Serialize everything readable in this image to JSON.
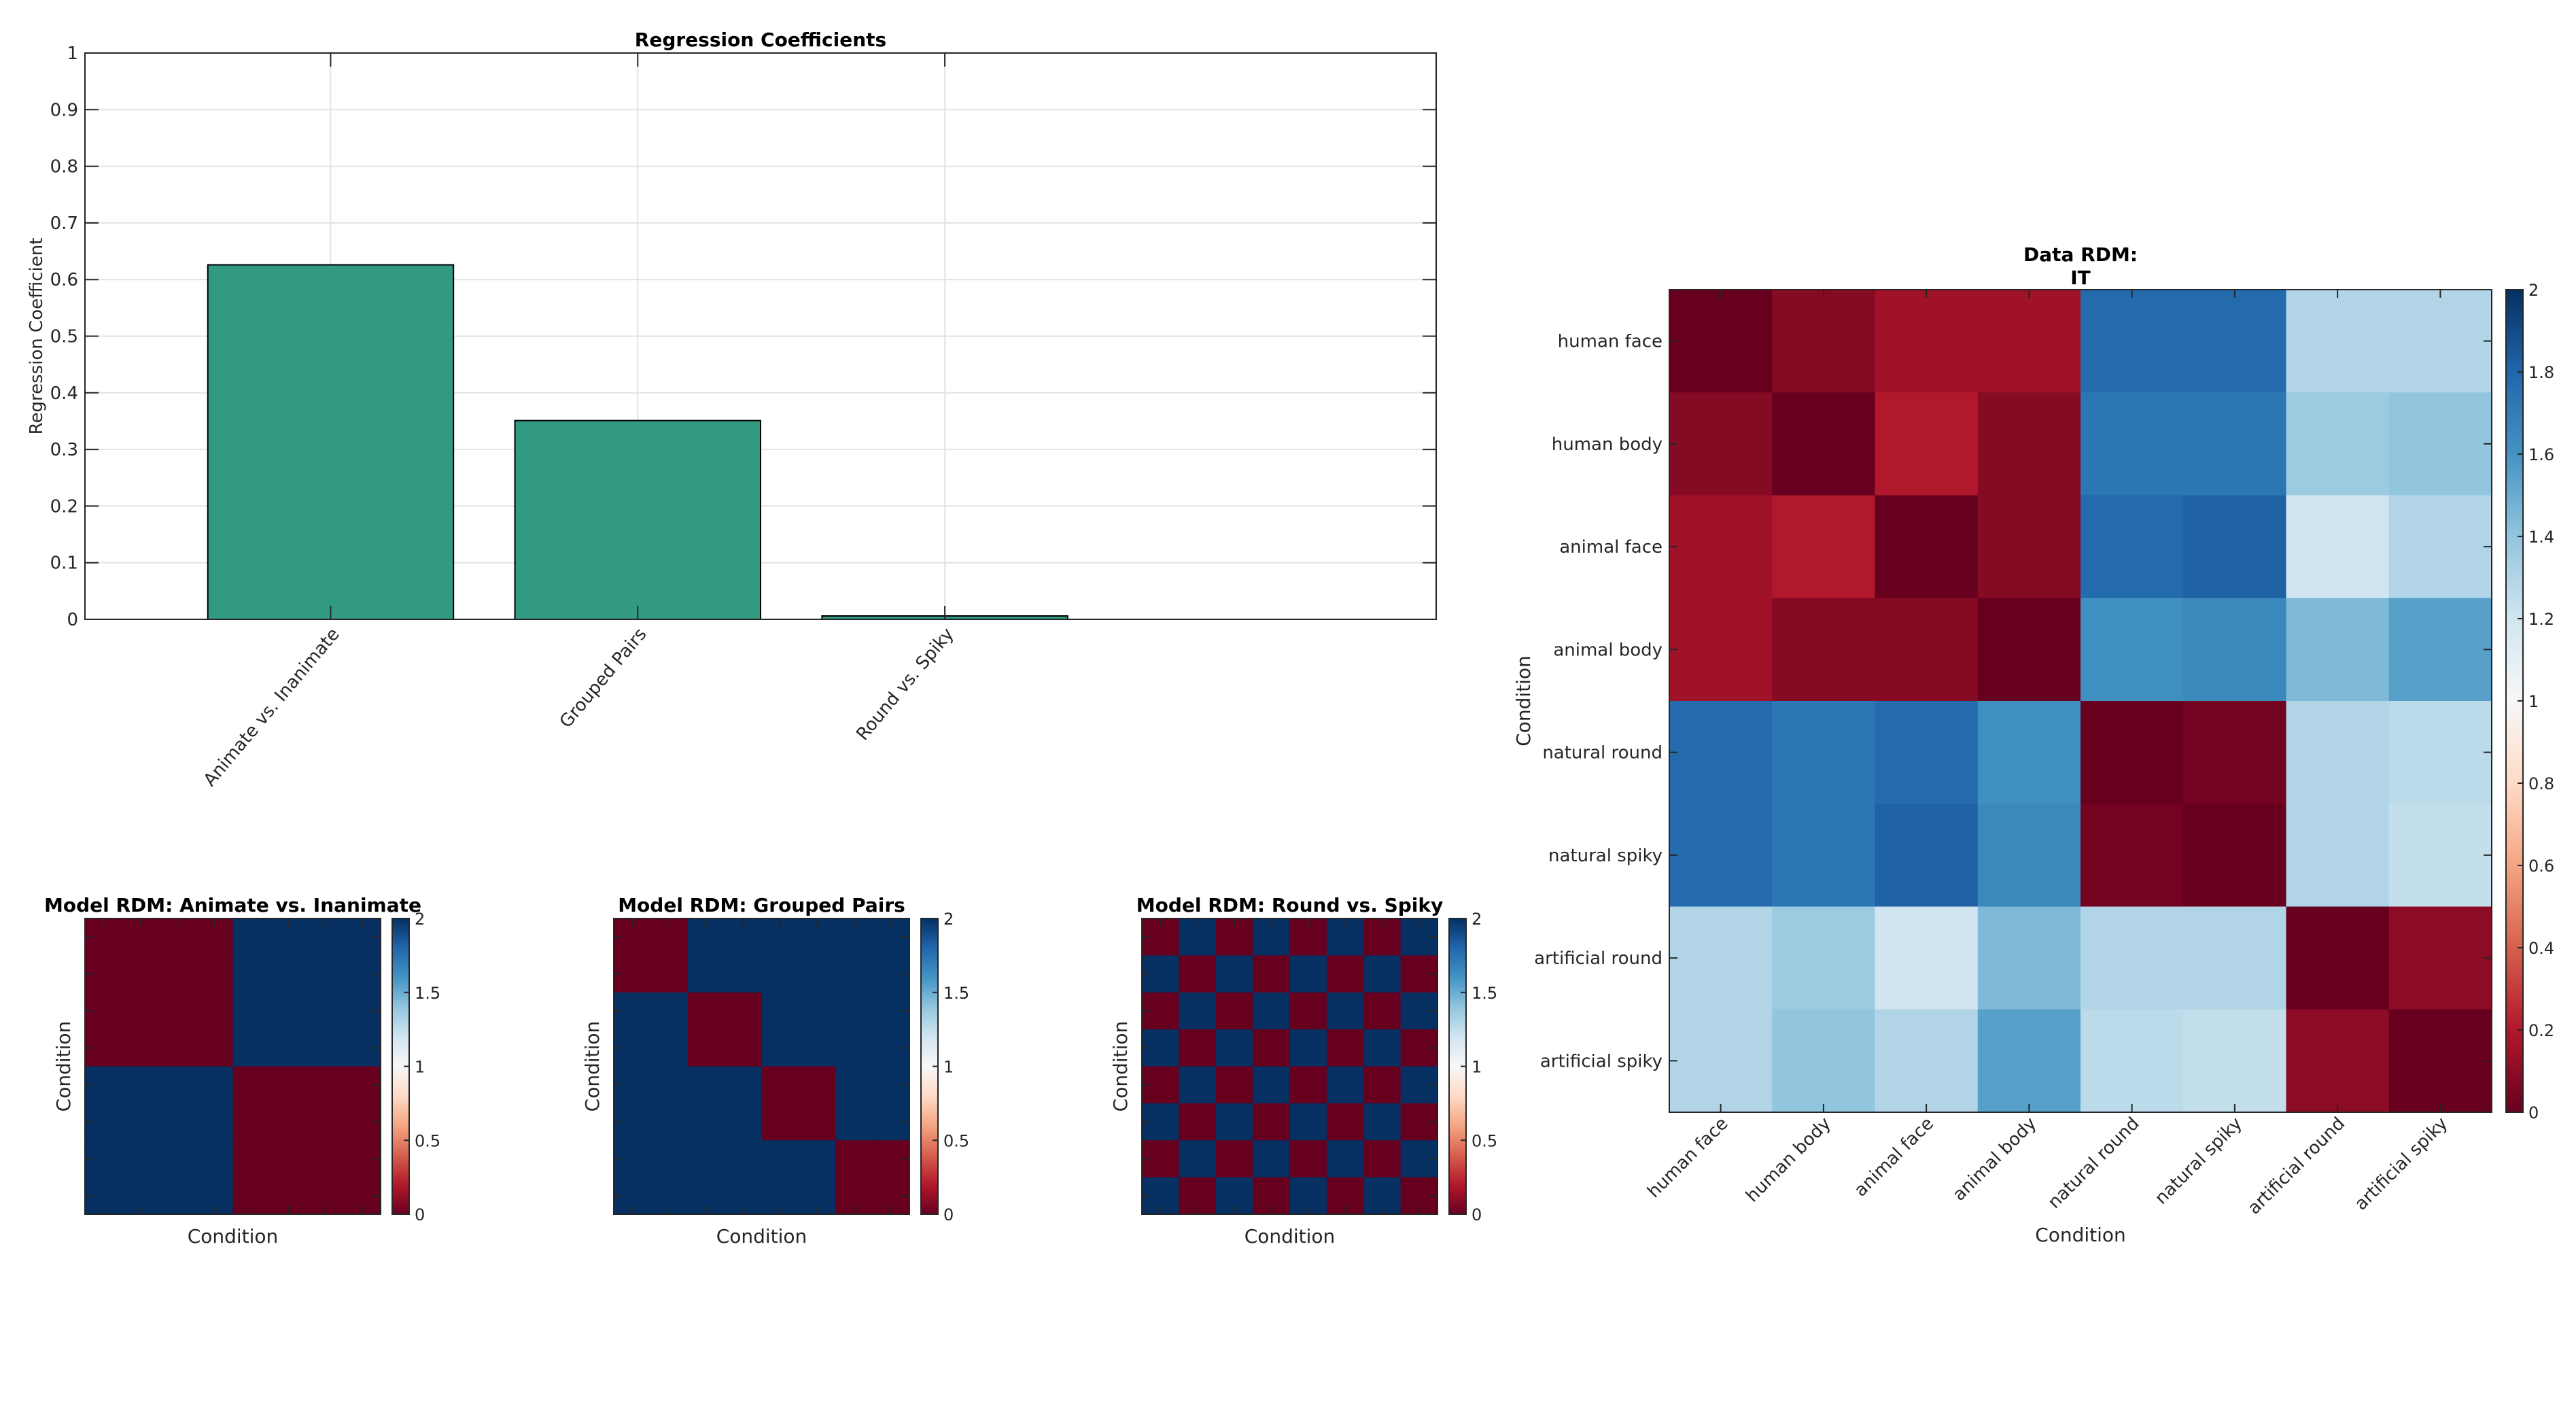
{
  "chart_data": [
    {
      "id": "regression",
      "type": "bar",
      "title": "Regression Coefficients",
      "xlabel": "",
      "ylabel": "Regression Coefficient",
      "categories": [
        "Animate vs. Inanimate",
        "Grouped Pairs",
        "Round vs. Spiky"
      ],
      "values": [
        0.626,
        0.351,
        0.006
      ],
      "ylim": [
        0,
        1
      ],
      "yticks": [
        0,
        0.1,
        0.2,
        0.3,
        0.4,
        0.5,
        0.6,
        0.7,
        0.8,
        0.9,
        1
      ],
      "ytick_labels": [
        "0",
        "0.1",
        "0.2",
        "0.3",
        "0.4",
        "0.5",
        "0.6",
        "0.7",
        "0.8",
        "0.9",
        "1"
      ],
      "grid": true,
      "bar_color": "#339A82"
    },
    {
      "id": "model_animate",
      "type": "heatmap",
      "title": "Model RDM: Animate vs. Inanimate",
      "xlabel": "Condition",
      "ylabel": "Condition",
      "colormap": "RdBu",
      "clim": [
        0,
        2
      ],
      "colorbar_ticks": [
        0,
        0.5,
        1,
        1.5,
        2
      ],
      "colorbar_labels": [
        "0",
        "0.5",
        "1",
        "1.5",
        "2"
      ],
      "matrix": [
        [
          0,
          0,
          0,
          0,
          2,
          2,
          2,
          2
        ],
        [
          0,
          0,
          0,
          0,
          2,
          2,
          2,
          2
        ],
        [
          0,
          0,
          0,
          0,
          2,
          2,
          2,
          2
        ],
        [
          0,
          0,
          0,
          0,
          2,
          2,
          2,
          2
        ],
        [
          2,
          2,
          2,
          2,
          0,
          0,
          0,
          0
        ],
        [
          2,
          2,
          2,
          2,
          0,
          0,
          0,
          0
        ],
        [
          2,
          2,
          2,
          2,
          0,
          0,
          0,
          0
        ],
        [
          2,
          2,
          2,
          2,
          0,
          0,
          0,
          0
        ]
      ]
    },
    {
      "id": "model_pairs",
      "type": "heatmap",
      "title": "Model RDM: Grouped Pairs",
      "xlabel": "Condition",
      "ylabel": "Condition",
      "colormap": "RdBu",
      "clim": [
        0,
        2
      ],
      "colorbar_ticks": [
        0,
        0.5,
        1,
        1.5,
        2
      ],
      "colorbar_labels": [
        "0",
        "0.5",
        "1",
        "1.5",
        "2"
      ],
      "matrix": [
        [
          0,
          0,
          2,
          2,
          2,
          2,
          2,
          2
        ],
        [
          0,
          0,
          2,
          2,
          2,
          2,
          2,
          2
        ],
        [
          2,
          2,
          0,
          0,
          2,
          2,
          2,
          2
        ],
        [
          2,
          2,
          0,
          0,
          2,
          2,
          2,
          2
        ],
        [
          2,
          2,
          2,
          2,
          0,
          0,
          2,
          2
        ],
        [
          2,
          2,
          2,
          2,
          0,
          0,
          2,
          2
        ],
        [
          2,
          2,
          2,
          2,
          2,
          2,
          0,
          0
        ],
        [
          2,
          2,
          2,
          2,
          2,
          2,
          0,
          0
        ]
      ]
    },
    {
      "id": "model_roundspiky",
      "type": "heatmap",
      "title": "Model RDM: Round vs. Spiky",
      "xlabel": "Condition",
      "ylabel": "Condition",
      "colormap": "RdBu",
      "clim": [
        0,
        2
      ],
      "colorbar_ticks": [
        0,
        0.5,
        1,
        1.5,
        2
      ],
      "colorbar_labels": [
        "0",
        "0.5",
        "1",
        "1.5",
        "2"
      ],
      "matrix": [
        [
          0,
          2,
          0,
          2,
          0,
          2,
          0,
          2
        ],
        [
          2,
          0,
          2,
          0,
          2,
          0,
          2,
          0
        ],
        [
          0,
          2,
          0,
          2,
          0,
          2,
          0,
          2
        ],
        [
          2,
          0,
          2,
          0,
          2,
          0,
          2,
          0
        ],
        [
          0,
          2,
          0,
          2,
          0,
          2,
          0,
          2
        ],
        [
          2,
          0,
          2,
          0,
          2,
          0,
          2,
          0
        ],
        [
          0,
          2,
          0,
          2,
          0,
          2,
          0,
          2
        ],
        [
          2,
          0,
          2,
          0,
          2,
          0,
          2,
          0
        ]
      ]
    },
    {
      "id": "data_rdm",
      "type": "heatmap",
      "title": "Data RDM:",
      "subtitle": "IT",
      "xlabel": "Condition",
      "ylabel": "Condition",
      "colormap": "RdBu",
      "clim": [
        0,
        2
      ],
      "colorbar_ticks": [
        0,
        0.2,
        0.4,
        0.6,
        0.8,
        1,
        1.2,
        1.4,
        1.6,
        1.8,
        2
      ],
      "colorbar_labels": [
        "0",
        "0.2",
        "0.4",
        "0.6",
        "0.8",
        "1",
        "1.2",
        "1.4",
        "1.6",
        "1.8",
        "2"
      ],
      "labels": [
        "human face",
        "human body",
        "animal face",
        "animal body",
        "natural round",
        "natural spiky",
        "artificial round",
        "artificial spiky"
      ],
      "matrix": [
        [
          0.0,
          0.08,
          0.15,
          0.15,
          1.78,
          1.78,
          1.3,
          1.3
        ],
        [
          0.08,
          0.0,
          0.2,
          0.08,
          1.73,
          1.73,
          1.37,
          1.4
        ],
        [
          0.15,
          0.2,
          0.0,
          0.08,
          1.78,
          1.82,
          1.2,
          1.3
        ],
        [
          0.15,
          0.08,
          0.08,
          0.0,
          1.62,
          1.65,
          1.45,
          1.55
        ],
        [
          1.78,
          1.73,
          1.78,
          1.62,
          0.0,
          0.03,
          1.3,
          1.27
        ],
        [
          1.78,
          1.73,
          1.82,
          1.65,
          0.03,
          0.0,
          1.3,
          1.24
        ],
        [
          1.3,
          1.37,
          1.2,
          1.45,
          1.3,
          1.3,
          0.0,
          0.1
        ],
        [
          1.3,
          1.4,
          1.3,
          1.55,
          1.27,
          1.24,
          0.1,
          0.0
        ]
      ]
    }
  ]
}
